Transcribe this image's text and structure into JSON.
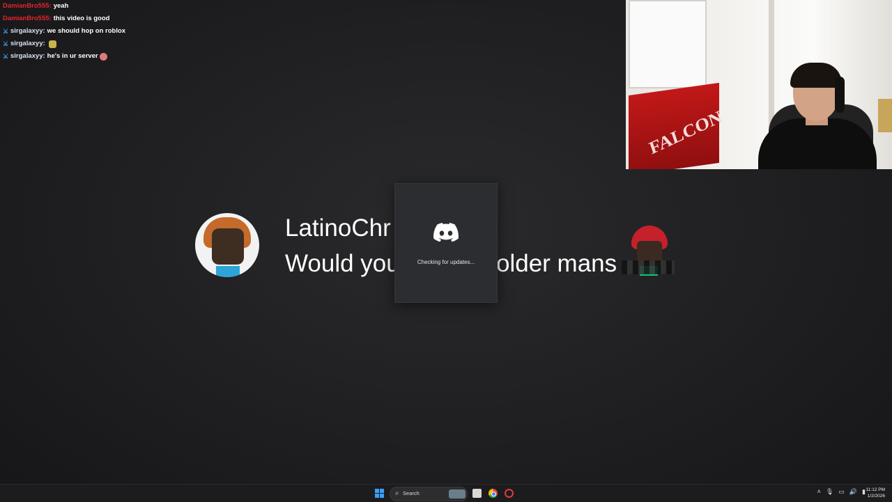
{
  "chat": {
    "messages": [
      {
        "user": "DamianBro555:",
        "text": "yeah",
        "color": "#e3242b",
        "badge": false
      },
      {
        "user": "DamianBro555:",
        "text": "this video is good",
        "color": "#e3242b",
        "badge": false
      },
      {
        "user": "sirgalaxyy:",
        "text": "we should hop on roblox",
        "color": "#d8e3f0",
        "badge": true
      },
      {
        "user": "sirgalaxyy:",
        "text": "",
        "color": "#d8e3f0",
        "badge": true,
        "emote": "emote"
      },
      {
        "user": "sirgalaxyy:",
        "text": "he's in ur server",
        "color": "#d8e3f0",
        "badge": true,
        "emote": "round"
      }
    ]
  },
  "video": {
    "username": "LatinoChr",
    "message_left": "Would you",
    "message_right": "older mans"
  },
  "updater": {
    "status": "Checking for updates..."
  },
  "taskbar": {
    "search_label": "Search",
    "time": "11:12 PM",
    "date": "1/2/2026"
  },
  "colors": {
    "accent": "#3aa0ff",
    "updater_bg": "#2b2d31"
  }
}
